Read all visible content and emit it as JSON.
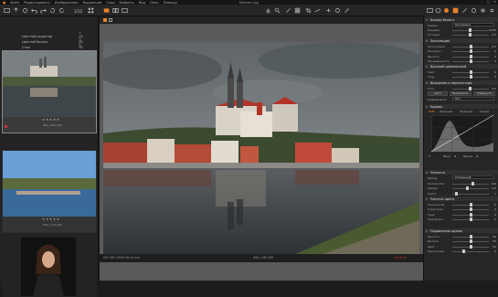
{
  "menubar": {
    "items": [
      "Файл",
      "Редактировать",
      "Изображения",
      "Коррекция",
      "Слои",
      "Выбрать",
      "Вид",
      "Окно",
      "Помощь"
    ],
    "title": "Meissen.jpg"
  },
  "toolbar": {
    "counter": "1/12"
  },
  "browser": {
    "collections": [
      {
        "label": "Цветной редактор"
      },
      {
        "label": "Цветной баланс"
      },
      {
        "label": "Слои"
      }
    ],
    "thumbnails": [
      {
        "name": "IMG_1087.JPG",
        "rating": "★★★★★",
        "selected": true
      },
      {
        "name": "IMG_1124.JPG",
        "rating": "★★★★★",
        "selected": false
      },
      {
        "name": "",
        "rating": "",
        "selected": false
      }
    ]
  },
  "viewer": {
    "status_left": "ISO 160   1/500   f/8   24 mm",
    "status_center": "IMG_1087.JPG",
    "status_right": "★★★★★"
  },
  "panel": {
    "sections": {
      "white_balance": "Баланс белого",
      "exposure": "Экспозиция",
      "hdr": "Высокий динамичный",
      "rotation": "Вращение и перспектива",
      "levels": "Кривая",
      "sharpening": "Четкость",
      "clarity": "Чистота цвета",
      "noise": "Подавление шумов"
    },
    "wb": {
      "mode_label": "Режим",
      "mode_value": "Настройка",
      "kelvin_label": "Кельвин",
      "kelvin_value": "5100",
      "tint_label": "Оттенок",
      "tint_value": "0,0"
    },
    "exposure": {
      "rows": [
        {
          "label": "Экспозиция",
          "value": "0,0",
          "pos": 0.5
        },
        {
          "label": "Контраст",
          "value": "0",
          "pos": 0.5
        },
        {
          "label": "Яркость",
          "value": "0",
          "pos": 0.5
        },
        {
          "label": "Насыщенность",
          "value": "0",
          "pos": 0.5
        }
      ]
    },
    "hdr": {
      "rows": [
        {
          "label": "Свет",
          "value": "0",
          "pos": 0.5
        },
        {
          "label": "Тень",
          "value": "0",
          "pos": 0.5
        }
      ]
    },
    "rotation": {
      "angle_label": "Угол",
      "angle_value": "0,0",
      "btn_auto": "Авто",
      "btn_straighten": "Выпрямить",
      "btn_rotate": "Повернуть",
      "crop_label": "Кадрировать",
      "crop_value": "Нет"
    },
    "curve": {
      "tabs": [
        "RGB",
        "Красный",
        "Зеленый",
        "Синий"
      ],
      "input_label": "Ввод",
      "input_value": "0",
      "output_label": "Вывод",
      "output_value": "0"
    },
    "sharpening": {
      "method_label": "Метод",
      "method_value": "Усиленный",
      "rows": [
        {
          "label": "Количество",
          "value": "140",
          "pos": 0.55
        },
        {
          "label": "Радиус",
          "value": "0,8",
          "pos": 0.4
        },
        {
          "label": "Порог",
          "value": "1",
          "pos": 0.1
        }
      ]
    },
    "clarity": {
      "rows": [
        {
          "label": "Количество",
          "value": "0",
          "pos": 0.5
        },
        {
          "label": "Структура",
          "value": "0",
          "pos": 0.5
        },
        {
          "label": "Тени",
          "value": "0",
          "pos": 0.5
        },
        {
          "label": "Подсветка",
          "value": "0",
          "pos": 0.5
        }
      ]
    },
    "noise": {
      "rows": [
        {
          "label": "Яркость",
          "value": "50",
          "pos": 0.5
        },
        {
          "label": "Детали",
          "value": "50",
          "pos": 0.5
        },
        {
          "label": "Цвет",
          "value": "50",
          "pos": 0.5
        },
        {
          "label": "Единичные",
          "value": "0",
          "pos": 0.3
        }
      ]
    }
  },
  "colors": {
    "accent": "#e8832a",
    "background": "#1c1c1c",
    "panel": "#262626"
  }
}
